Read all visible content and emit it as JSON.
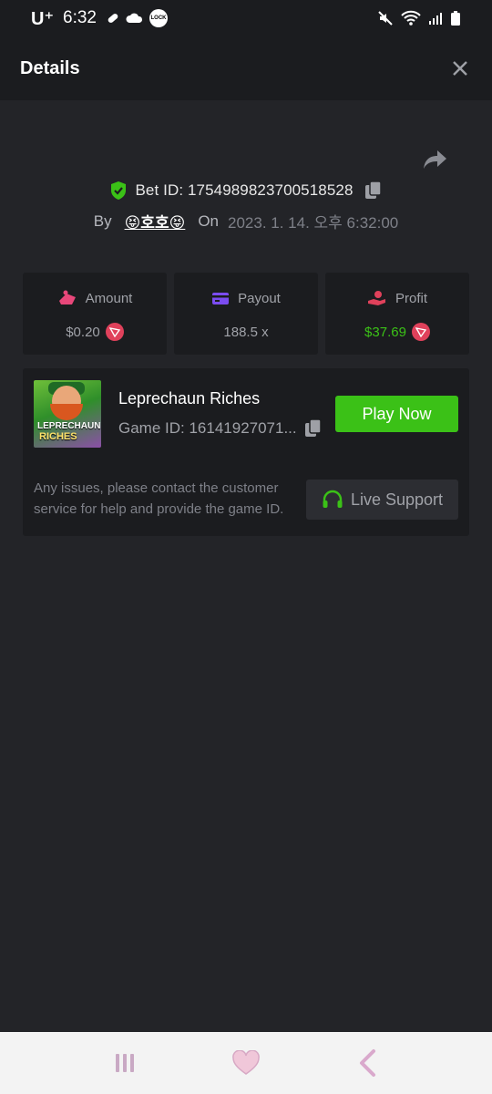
{
  "status_bar": {
    "carrier": "U⁺",
    "time": "6:32",
    "lock_badge": "LOCK"
  },
  "header": {
    "title": "Details"
  },
  "bet": {
    "id_label": "Bet ID: 1754989823700518528",
    "by_label": "By",
    "user": "😝호호😝",
    "on_label": "On",
    "date": "2023. 1. 14. 오후 6:32:00"
  },
  "stats": {
    "amount": {
      "label": "Amount",
      "value": "$0.20"
    },
    "payout": {
      "label": "Payout",
      "value": "188.5 x"
    },
    "profit": {
      "label": "Profit",
      "value": "$37.69"
    }
  },
  "game": {
    "name": "Leprechaun Riches",
    "id_label": "Game ID: 16141927071...",
    "thumb_line1": "LEPRECHAUN",
    "thumb_line2": "RICHES",
    "play_label": "Play Now"
  },
  "support": {
    "help_text": "Any issues, please contact the customer service for help and provide the game ID.",
    "button_label": "Live Support"
  },
  "colors": {
    "background": "#232428",
    "panel": "#1b1c1f",
    "accent_green": "#3bc117",
    "trx_red": "#e0415b",
    "payout_purple": "#7b4cf0",
    "amount_pink": "#e8477a"
  }
}
